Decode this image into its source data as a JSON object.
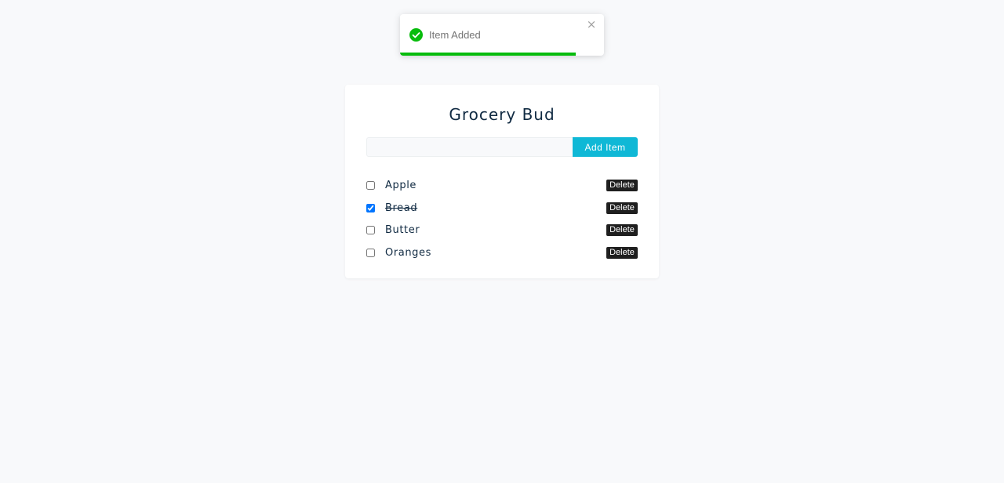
{
  "toast": {
    "message": "Item Added",
    "icon": "check-circle-icon",
    "close_glyph": "×",
    "progress": 0.86,
    "colors": {
      "success": "#07bc0c"
    }
  },
  "app": {
    "title": "Grocery Bud",
    "input": {
      "value": "",
      "placeholder": ""
    },
    "add_label": "Add Item",
    "accent_color": "#0fb8d6"
  },
  "items": [
    {
      "name": "Apple",
      "completed": false,
      "delete_label": "Delete"
    },
    {
      "name": "Bread",
      "completed": true,
      "delete_label": "Delete"
    },
    {
      "name": "Butter",
      "completed": false,
      "delete_label": "Delete"
    },
    {
      "name": "Oranges",
      "completed": false,
      "delete_label": "Delete"
    }
  ]
}
